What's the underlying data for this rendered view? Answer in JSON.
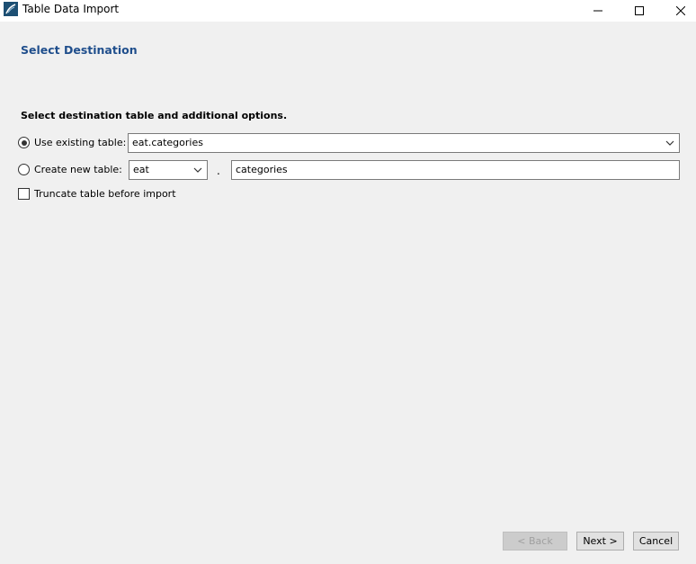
{
  "window": {
    "title": "Table Data Import",
    "controls": {
      "minimize": "minimize",
      "maximize": "maximize",
      "close": "close"
    }
  },
  "page": {
    "section_title": "Select Destination",
    "instructions": "Select destination table and additional options."
  },
  "options": {
    "use_existing": {
      "label": "Use existing table:",
      "selected": true,
      "value": "eat.categories"
    },
    "create_new": {
      "label": "Create new table:",
      "selected": false,
      "schema_value": "eat",
      "separator": ".",
      "table_value": "categories"
    },
    "truncate": {
      "label": "Truncate table before import",
      "checked": false
    }
  },
  "buttons": {
    "back": "< Back",
    "next": "Next >",
    "cancel": "Cancel"
  },
  "colors": {
    "section_title": "#1f4e8c",
    "window_bg": "#f0f0f0",
    "titlebar_bg": "#ffffff"
  }
}
